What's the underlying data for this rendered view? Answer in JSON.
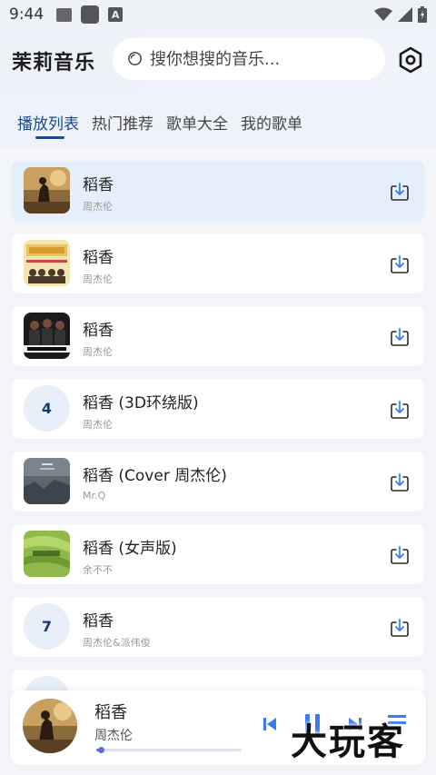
{
  "status_bar": {
    "time": "9:44"
  },
  "app": {
    "title": "茉莉音乐"
  },
  "search": {
    "placeholder": "搜你想搜的音乐..."
  },
  "tabs": [
    {
      "label": "播放列表",
      "active": true
    },
    {
      "label": "热门推荐",
      "active": false
    },
    {
      "label": "歌单大全",
      "active": false
    },
    {
      "label": "我的歌单",
      "active": false
    }
  ],
  "songs": [
    {
      "title": "稻香",
      "artist": "周杰伦",
      "cover": "image"
    },
    {
      "title": "稻香",
      "artist": "周杰伦",
      "cover": "image"
    },
    {
      "title": "稻香",
      "artist": "周杰伦",
      "cover": "image"
    },
    {
      "title": "稻香 (3D环绕版)",
      "artist": "周杰伦",
      "cover": "number",
      "number": "4"
    },
    {
      "title": "稻香 (Cover 周杰伦)",
      "artist": "Mr.Q",
      "cover": "image"
    },
    {
      "title": "稻香 (女声版)",
      "artist": "余不不",
      "cover": "image"
    },
    {
      "title": "稻香",
      "artist": "周杰伦&派伟俊",
      "cover": "number",
      "number": "7"
    }
  ],
  "player": {
    "title": "稻香",
    "artist": "周杰伦",
    "progress": 0.03
  },
  "watermark": "大玩客",
  "colors": {
    "accent": "#1a4a8c",
    "active_row": "#e4effb",
    "progress": "#5b6fd8",
    "control": "#3a7cf0"
  },
  "icons": {
    "search": "search-icon",
    "settings": "settings-icon",
    "download": "download-icon",
    "prev": "previous-icon",
    "play_pause": "pause-icon",
    "next": "next-icon",
    "playlist": "playlist-icon"
  }
}
